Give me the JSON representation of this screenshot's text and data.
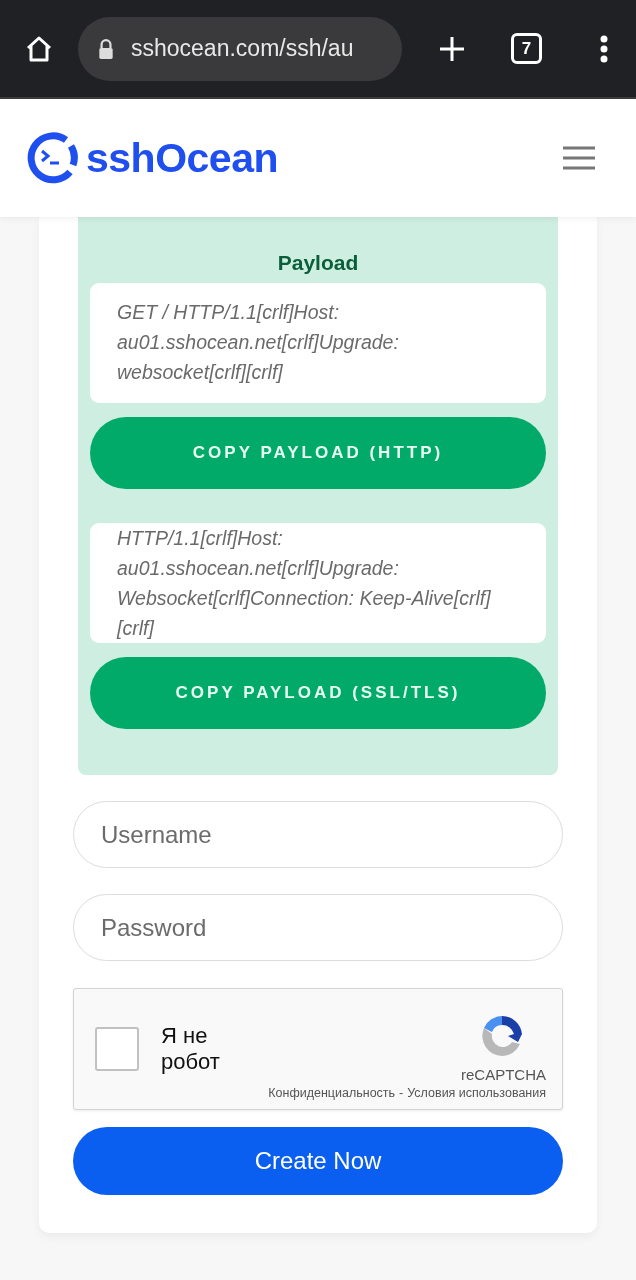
{
  "browser": {
    "url": "sshocean.com/ssh/au",
    "tab_count": "7"
  },
  "site": {
    "logo": "sshOcean"
  },
  "payload": {
    "title": "Payload",
    "blocks": [
      {
        "text": "GET / HTTP/1.1[crlf]Host: au01.sshocean.net[crlf]Upgrade: websocket[crlf][crlf]",
        "button": "COPY PAYLOAD (HTTP)"
      },
      {
        "text": "HTTP/1.1[crlf]Host: au01.sshocean.net[crlf]Upgrade: Websocket[crlf]Connection: Keep-Alive[crlf][crlf]",
        "button": "COPY PAYLOAD (SSL/TLS)"
      }
    ]
  },
  "form": {
    "fields": [
      {
        "placeholder": "Username"
      },
      {
        "placeholder": "Password"
      }
    ],
    "captcha": {
      "label": "Я не робот",
      "checked": false,
      "brand": "reCAPTCHA",
      "privacy": "Конфиденциальность",
      "separator": "-",
      "terms": "Условия использования"
    },
    "submit": "Create Now"
  }
}
